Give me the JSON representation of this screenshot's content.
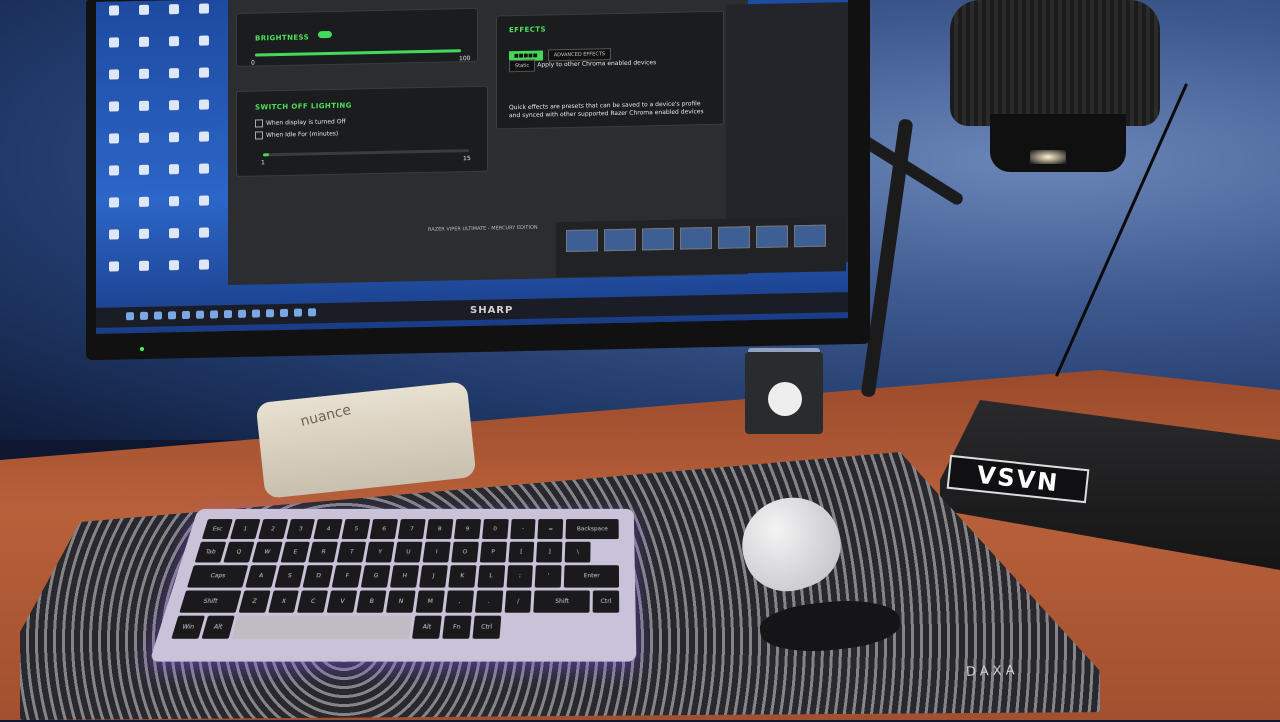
{
  "screen": {
    "app": {
      "brightness_label": "BRIGHTNESS",
      "brightness_value": "100",
      "brightness_min": "0",
      "brightness_level": 1.0,
      "switch_off_label": "SWITCH OFF LIGHTING",
      "option_display_off": "When display is turned Off",
      "option_idle": "When Idle For (minutes)",
      "idle_value": "15",
      "idle_min": "1",
      "idle_level": 0.02,
      "effects_label": "EFFECTS",
      "advanced_effects_label": "ADVANCED EFFECTS",
      "apply_other_label": "Apply to other Chroma enabled devices",
      "static_label": "Static",
      "effects_help": "Quick effects are presets that can be saved to a device's profile and synced with other supported Razer Chroma enabled devices",
      "footer_title": "RAZER VIPER ULTIMATE - MERCURY EDITION"
    },
    "taskbar_brand": "SHARP"
  },
  "desk": {
    "laptop_brand": "VSVN",
    "mousepad_brand": "DAXA",
    "pouch_text": "nuance"
  },
  "keyboard": {
    "keys": [
      "Esc",
      "1",
      "2",
      "3",
      "4",
      "5",
      "6",
      "7",
      "8",
      "9",
      "0",
      "-",
      "=",
      "Backspace",
      "Tab",
      "Q",
      "W",
      "E",
      "R",
      "T",
      "Y",
      "U",
      "I",
      "O",
      "P",
      "[",
      "]",
      "\\",
      "Caps",
      "A",
      "S",
      "D",
      "F",
      "G",
      "H",
      "J",
      "K",
      "L",
      ";",
      "'",
      "Enter",
      "Shift",
      "Z",
      "X",
      "C",
      "V",
      "B",
      "N",
      "M",
      ",",
      ".",
      "/",
      "Shift",
      "Ctrl",
      "Win",
      "Alt",
      "",
      "Alt",
      "Fn",
      "Ctrl"
    ]
  }
}
